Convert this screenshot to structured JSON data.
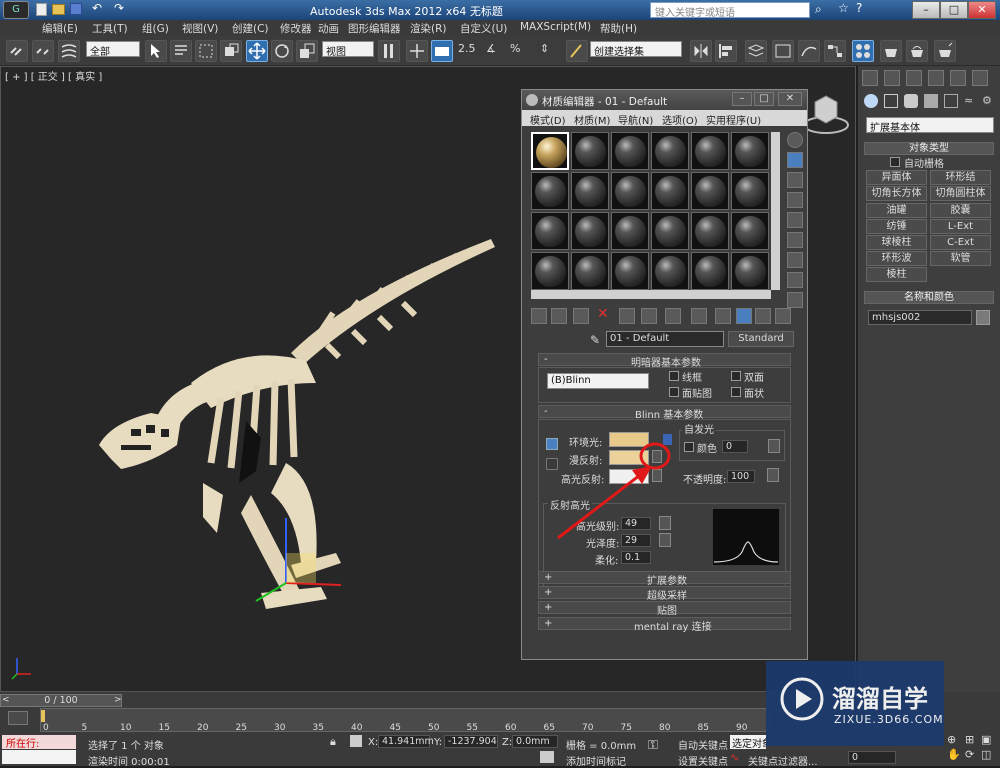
{
  "window": {
    "app_title": "Autodesk 3ds Max  2012 x64      无标题",
    "search_placeholder": "键入关键字或短语"
  },
  "menubar": [
    "编辑(E)",
    "工具(T)",
    "组(G)",
    "视图(V)",
    "创建(C)",
    "修改器",
    "动画",
    "图形编辑器",
    "渲染(R)",
    "自定义(U)",
    "MAXScript(M)",
    "帮助(H)"
  ],
  "toolbar": {
    "selection_filter": "全部",
    "reference_coord": "视图",
    "named_selection": "创建选择集",
    "snap_angle": "2.5"
  },
  "viewport": {
    "label": "[ + ] [ 正交 ] [ 真实 ]"
  },
  "command_panel": {
    "category": "扩展基本体",
    "object_type_header": "对象类型",
    "autogrid": "自动栅格",
    "object_buttons": [
      "异面体",
      "环形结",
      "切角长方体",
      "切角圆柱体",
      "油罐",
      "胶囊",
      "纺锤",
      "L-Ext",
      "球棱柱",
      "C-Ext",
      "环形波",
      "软管",
      "棱柱"
    ],
    "name_color_header": "名称和颜色",
    "object_name": "mhsjs002"
  },
  "material_editor": {
    "title": "材质编辑器 - 01 - Default",
    "menu": [
      "模式(D)",
      "材质(M)",
      "导航(N)",
      "选项(O)",
      "实用程序(U)"
    ],
    "material_name": "01 - Default",
    "material_type": "Standard",
    "shader_rollout": "明暗器基本参数",
    "shader": "(B)Blinn",
    "shader_options": [
      "线框",
      "双面",
      "面贴图",
      "面状"
    ],
    "blinn_rollout": "Blinn 基本参数",
    "self_illum": {
      "title": "自发光",
      "color_label": "颜色",
      "value": "0"
    },
    "ambient_label": "环境光:",
    "diffuse_label": "漫反射:",
    "specular_label": "高光反射:",
    "opacity_label": "不透明度:",
    "opacity_value": "100",
    "specular_highlights": {
      "title": "反射高光",
      "level_label": "高光级别:",
      "level_value": "49",
      "gloss_label": "光泽度:",
      "gloss_value": "29",
      "soften_label": "柔化:",
      "soften_value": "0.1"
    },
    "rollouts": [
      "扩展参数",
      "超级采样",
      "贴图",
      "mental ray 连接"
    ],
    "colors": {
      "ambient": "#e8c98a",
      "diffuse": "#ecd19a",
      "specular": "#f0f0f0"
    }
  },
  "timeline": {
    "slider": "0 / 100",
    "ticks": [
      "0",
      "5",
      "10",
      "15",
      "20",
      "25",
      "30",
      "35",
      "40",
      "45",
      "50",
      "55",
      "60",
      "65",
      "70",
      "75",
      "80",
      "85",
      "90"
    ]
  },
  "status": {
    "mode": "所在行:",
    "selection_msg": "选择了 1 个 对象",
    "render_time": "渲染时间 0:00:01",
    "x_label": "X:",
    "x_value": "41.941mm",
    "y_label": "Y:",
    "y_value": "-1237.904",
    "z_label": "Z:",
    "z_value": "0.0mm",
    "grid": "栅格 = 0.0mm",
    "add_time_tag": "添加时间标记",
    "auto_key": "自动关键点",
    "selected": "选定对象",
    "set_key": "设置关键点",
    "key_filters": "关键点过滤器...",
    "frame": "0"
  },
  "watermark": {
    "brand": "溜溜自学",
    "url": "ZIXUE.3D66.COM"
  }
}
